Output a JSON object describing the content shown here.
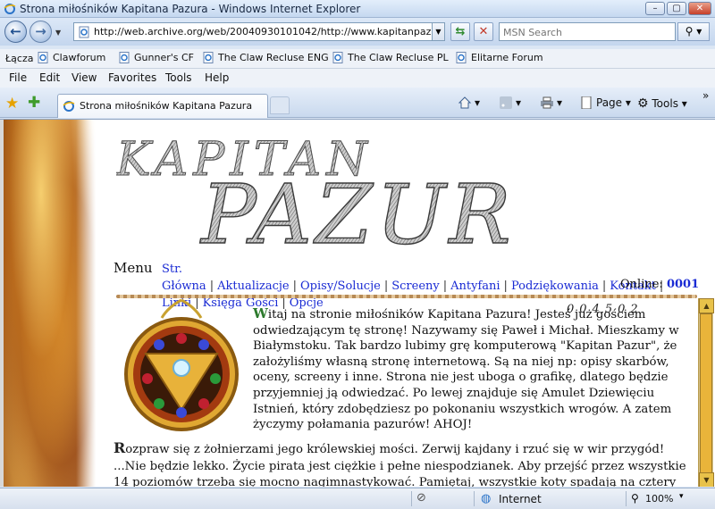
{
  "window": {
    "title": "Strona miłośników Kapitana Pazura - Windows Internet Explorer",
    "minimize_label": "–",
    "maximize_label": "▢",
    "close_label": "✕"
  },
  "address": {
    "url": "http://web.archive.org/web/20040930101042/http://www.kapitanpazur.prv.pl/",
    "search_placeholder": "MSN Search"
  },
  "links_bar": {
    "label": "Łącza",
    "items": [
      "Clawforum",
      "Gunner's CF",
      "The Claw Recluse ENG",
      "The Claw Recluse PL",
      "Elitarne Forum"
    ]
  },
  "menu_bar": {
    "items": [
      "File",
      "Edit",
      "View",
      "Favorites",
      "Tools",
      "Help"
    ]
  },
  "tab": {
    "label": "Strona miłośników Kapitana Pazura"
  },
  "commands": {
    "page_label": "Page",
    "tools_label": "Tools"
  },
  "site": {
    "logo_line1": "KAPITAN",
    "logo_line2": "PAZUR",
    "menu_label": "Menu",
    "nav": [
      "Str. Główna",
      "Aktualizacje",
      "Opisy/Solucje",
      "Screeny",
      "Antyfani",
      "Podziękowania",
      "Kontakt",
      "Linki",
      "Księga Gości",
      "Opcje"
    ],
    "online_label": "Online:",
    "online_count": "0001",
    "counter": "004502",
    "welcome_first_letter": "W",
    "welcome_text": "itaj na stronie miłośników Kapitana Pazura! Jesteś już gościem odwiedzającym tę stronę! Nazywamy się Paweł i Michał. Mieszkamy w Białymstoku. Tak bardzo lubimy grę komputerową \"Kapitan Pazur\", że założyliśmy własną stronę internetową. Są na niej np: opisy skarbów, oceny, screeny i inne. Strona nie jest uboga o grafikę, dlatego będzie przyjemniej ją odwiedzać. Po lewej znajduje się Amulet Dziewięciu Istnień, który zdobędziesz po pokonaniu wszystkich wrogów. A zatem życzymy połamania pazurów! AHOJ!",
    "rozpraw_first_letter": "R",
    "rozpraw_text": "ozpraw się z żołnierzami jego królewskiej mości. Zerwij kajdany i rzuć się w wir przygód! ...Nie będzie lekko. Życie pirata jest ciężkie i pełne niespodzianek. Aby przejść przez wszystkie 14 poziomów trzeba się mocno nagimnastykować. Pamiętaj, wszystkie koty spadają na cztery łapy - oby i Tobie sprzyjało szczęście."
  },
  "status": {
    "zone": "Internet",
    "zoom": "100%"
  },
  "colors": {
    "link_blue": "#1a2bd4",
    "scrollbar_gold": "#e9b43a"
  }
}
